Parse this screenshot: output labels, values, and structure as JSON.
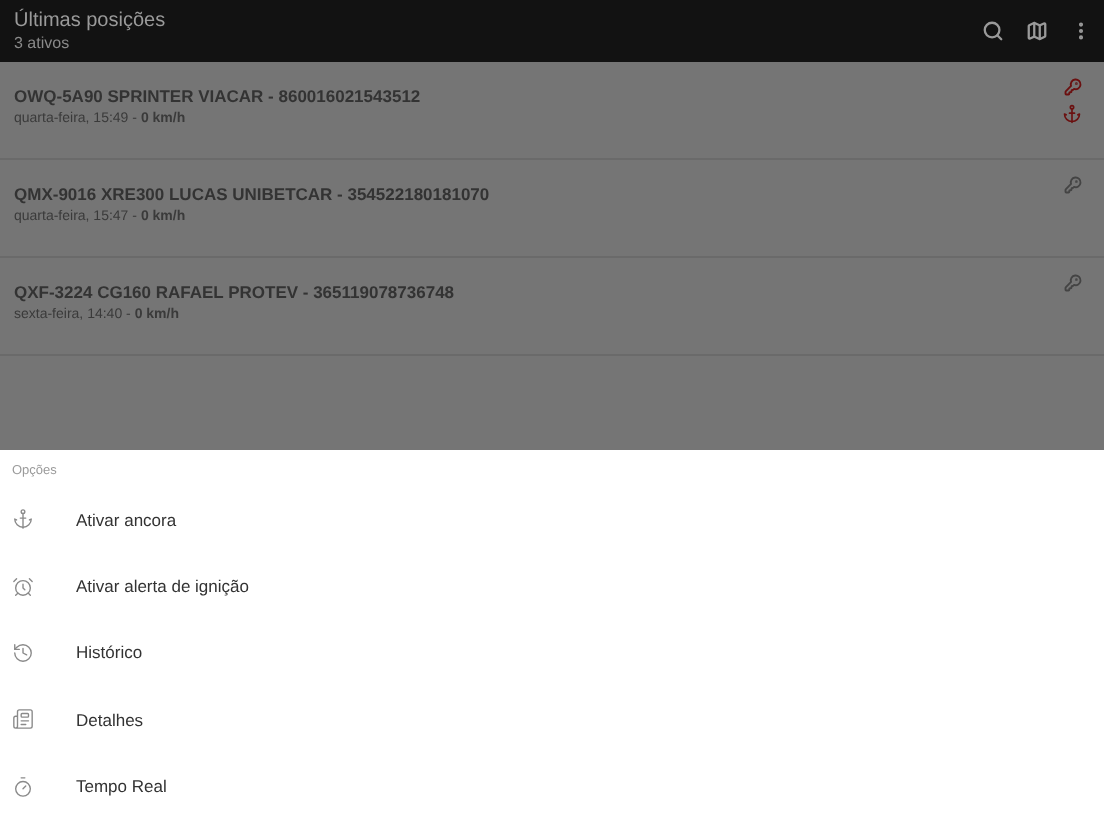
{
  "app_bar": {
    "title": "Últimas posições",
    "subtitle": "3 ativos"
  },
  "vehicles": [
    {
      "name": "OWQ-5A90 SPRINTER VIACAR - 860016021543512",
      "time": "quarta-feira, 15:49 - ",
      "speed": "0 km/h",
      "ignition_on": true,
      "anchored": true
    },
    {
      "name": "QMX-9016 XRE300 LUCAS UNIBETCAR - 354522180181070",
      "time": "quarta-feira, 15:47 - ",
      "speed": "0 km/h",
      "ignition_on": false,
      "anchored": false
    },
    {
      "name": "QXF-3224  CG160 RAFAEL PROTEV - 365119078736748",
      "time": "sexta-feira, 14:40 - ",
      "speed": "0 km/h",
      "ignition_on": false,
      "anchored": false
    }
  ],
  "sheet": {
    "title": "Opções",
    "options": [
      {
        "kind": "anchor",
        "label": "Ativar ancora"
      },
      {
        "kind": "alarm",
        "label": "Ativar alerta de ignição"
      },
      {
        "kind": "history",
        "label": "Histórico"
      },
      {
        "kind": "details",
        "label": "Detalhes"
      },
      {
        "kind": "timer",
        "label": "Tempo Real"
      }
    ]
  }
}
